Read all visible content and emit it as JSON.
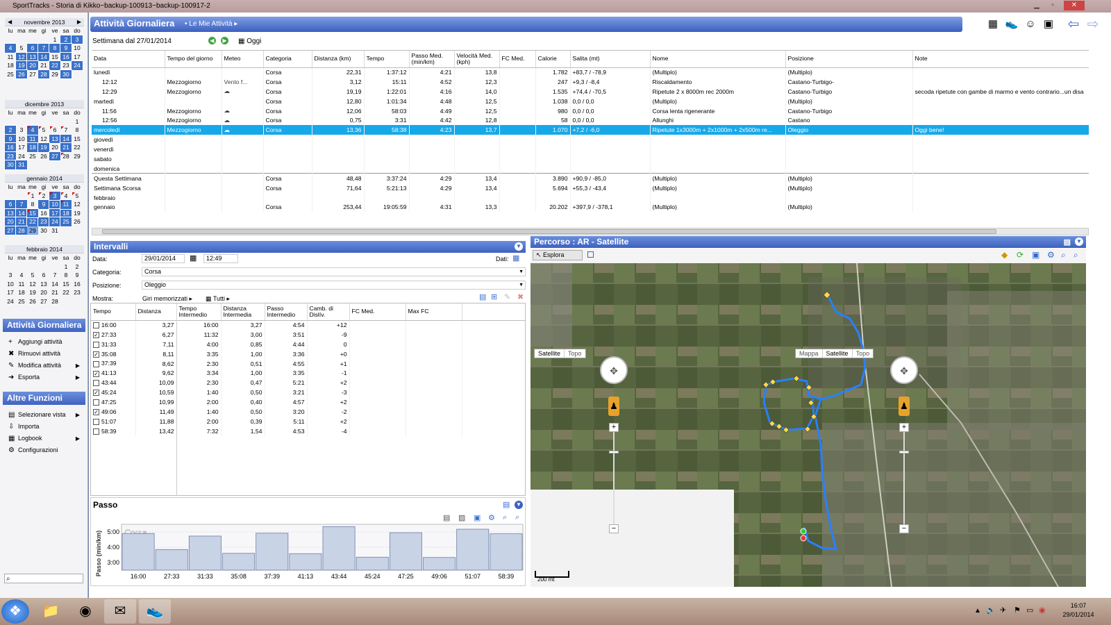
{
  "window": {
    "title": "SportTracks - Storia di Kikko~backup-100913~backup-100917-2"
  },
  "calendar": {
    "weekdays": [
      "lu",
      "ma",
      "me",
      "gi",
      "ve",
      "sa",
      "do"
    ],
    "months": [
      {
        "name": "novembre 2013",
        "lead": 4,
        "days": 30,
        "act": [
          2,
          3,
          4,
          6,
          7,
          8,
          9,
          12,
          13,
          14,
          16,
          19,
          20,
          22,
          24,
          26,
          28,
          30
        ],
        "flag": [],
        "today": []
      },
      {
        "name": "dicembre 2013",
        "lead": 6,
        "days": 31,
        "act": [
          2,
          4,
          9,
          11,
          13,
          14,
          16,
          18,
          19,
          21,
          23,
          27,
          30,
          31
        ],
        "flag": [
          4,
          5,
          6,
          7,
          28
        ],
        "today": []
      },
      {
        "name": "gennaio 2014",
        "lead": 2,
        "days": 31,
        "act": [
          3,
          6,
          7,
          9,
          10,
          11,
          13,
          14,
          15,
          17,
          18,
          20,
          21,
          22,
          23,
          24,
          25,
          27,
          28
        ],
        "flag": [
          1,
          2,
          3,
          4,
          5,
          11,
          15
        ],
        "today": [
          29
        ]
      },
      {
        "name": "febbraio 2014",
        "lead": 5,
        "days": 28,
        "act": [],
        "flag": [],
        "today": []
      }
    ]
  },
  "sidebar": {
    "panel1": {
      "title": "Attività Giornaliera",
      "items": [
        {
          "icon": "+",
          "label": "Aggiungi attività",
          "arrow": ""
        },
        {
          "icon": "✖",
          "label": "Rimuovi attività",
          "arrow": ""
        },
        {
          "icon": "✎",
          "label": "Modifica attività",
          "arrow": "▶"
        },
        {
          "icon": "➜",
          "label": "Esporta",
          "arrow": "▶"
        }
      ]
    },
    "panel2": {
      "title": "Altre Funzioni",
      "items": [
        {
          "icon": "▤",
          "label": "Selezionare vista",
          "arrow": "▶"
        },
        {
          "icon": "⇩",
          "label": "Importa",
          "arrow": ""
        },
        {
          "icon": "▦",
          "label": "Logbook",
          "arrow": "▶"
        },
        {
          "icon": "⚙",
          "label": "Configurazioni",
          "arrow": ""
        }
      ]
    }
  },
  "header": {
    "title": "Attività Giornaliera",
    "subtitle": "• Le Mie Attività ▸",
    "week": "Settimana dal 27/01/2014",
    "today": "Oggi"
  },
  "activities": {
    "columns": [
      "Data",
      "Tempo del giorno",
      "Meteo",
      "Categoria",
      "Distanza (km)",
      "Tempo",
      "Passo Med. (min/km)",
      "Velocità Med. (kph)",
      "FC Med.",
      "Calorie",
      "Salita (mt)",
      "Nome",
      "Posizione",
      "Note"
    ],
    "rows": [
      {
        "c": [
          "lunedì",
          "",
          "",
          "Corsa",
          "22,31",
          "1:37:12",
          "4:21",
          "13,8",
          "",
          "1.782",
          "+83,7 / -78,9",
          "(Multiplo)",
          "(Multiplo)",
          ""
        ],
        "t": "day"
      },
      {
        "c": [
          "12:12",
          "Mezzogiorno",
          "Vento f...",
          "Corsa",
          "3,12",
          "15:11",
          "4:52",
          "12,3",
          "",
          "247",
          "+9,3 / -8,4",
          "Riscaldamento",
          "Castano-Turbigo-",
          ""
        ],
        "t": "sub"
      },
      {
        "c": [
          "12:29",
          "Mezzogiorno",
          "☁",
          "Corsa",
          "19,19",
          "1:22:01",
          "4:16",
          "14,0",
          "",
          "1.535",
          "+74,4 / -70,5",
          "Ripetute 2 x 8000m rec 2000m",
          "Castano-Turbigo",
          "secoda ripetute con gambe di marmo e vento contrario...un disa"
        ],
        "t": "sub"
      },
      {
        "c": [
          "martedì",
          "",
          "",
          "Corsa",
          "12,80",
          "1:01:34",
          "4:48",
          "12,5",
          "",
          "1.038",
          "0,0 / 0,0",
          "(Multiplo)",
          "(Multiplo)",
          ""
        ],
        "t": "day"
      },
      {
        "c": [
          "11:56",
          "Mezzogiorno",
          "☁",
          "Corsa",
          "12,06",
          "58:03",
          "4:49",
          "12,5",
          "",
          "980",
          "0,0 / 0,0",
          "Corsa lenta rigenerante",
          "Castano-Turbigo",
          ""
        ],
        "t": "sub"
      },
      {
        "c": [
          "12:56",
          "Mezzogiorno",
          "☁",
          "Corsa",
          "0,75",
          "3:31",
          "4:42",
          "12,8",
          "",
          "58",
          "0,0 / 0,0",
          "Allunghi",
          "Castano",
          ""
        ],
        "t": "sub"
      },
      {
        "c": [
          "mercoledì",
          "Mezzogiorno",
          "☁",
          "Corsa",
          "13,36",
          "58:38",
          "4:23",
          "13,7",
          "",
          "1.070",
          "+7,2 / -6,0",
          "Ripetute 1x3000m + 2x1000m + 2x500m re...",
          "Oleggio",
          "Oggi bene!"
        ],
        "t": "sel"
      },
      {
        "c": [
          "giovedì",
          "",
          "",
          "",
          "",
          "",
          "",
          "",
          "",
          "",
          "",
          "",
          "",
          ""
        ],
        "t": "day"
      },
      {
        "c": [
          "venerdì",
          "",
          "",
          "",
          "",
          "",
          "",
          "",
          "",
          "",
          "",
          "",
          "",
          ""
        ],
        "t": "day"
      },
      {
        "c": [
          "sabato",
          "",
          "",
          "",
          "",
          "",
          "",
          "",
          "",
          "",
          "",
          "",
          "",
          ""
        ],
        "t": "day"
      },
      {
        "c": [
          "domenica",
          "",
          "",
          "",
          "",
          "",
          "",
          "",
          "",
          "",
          "",
          "",
          "",
          ""
        ],
        "t": "day"
      },
      {
        "c": [
          "Questa Settimana",
          "",
          "",
          "Corsa",
          "48,48",
          "3:37:24",
          "4:29",
          "13,4",
          "",
          "3.890",
          "+90,9 / -85,0",
          "(Multiplo)",
          "(Multiplo)",
          ""
        ],
        "t": "sep"
      },
      {
        "c": [
          "Settimana Scorsa",
          "",
          "",
          "Corsa",
          "71,64",
          "5:21:13",
          "4:29",
          "13,4",
          "",
          "5.694",
          "+55,3 / -43,4",
          "(Multiplo)",
          "(Multiplo)",
          ""
        ],
        "t": "day"
      },
      {
        "c": [
          "febbraio",
          "",
          "",
          "",
          "",
          "",
          "",
          "",
          "",
          "",
          "",
          "",
          "",
          ""
        ],
        "t": "day"
      },
      {
        "c": [
          "gennaio",
          "",
          "",
          "Corsa",
          "253,44",
          "19:05:59",
          "4:31",
          "13,3",
          "",
          "20.202",
          "+397,9 / -378,1",
          "(Multiplo)",
          "(Multiplo)",
          ""
        ],
        "t": "day"
      }
    ]
  },
  "intervals": {
    "title": "Intervalli",
    "date_label": "Data:",
    "date": "29/01/2014",
    "time": "12:49",
    "dati_label": "Dati:",
    "cat_label": "Categoria:",
    "cat": "Corsa",
    "pos_label": "Posizione:",
    "pos": "Oleggio",
    "show_label": "Mostra:",
    "show": "Giri memorizzati",
    "all": "Tutti",
    "columns": [
      "Tempo",
      "Distanza",
      "Tempo Intermedio",
      "Distanza Intermedia",
      "Passo Intermedio",
      "Camb. di Dislív.",
      "FC Med.",
      "Max FC"
    ],
    "rows": [
      {
        "ck": false,
        "c": [
          "16:00",
          "3,27",
          "16:00",
          "3,27",
          "4:54",
          "+12"
        ]
      },
      {
        "ck": true,
        "c": [
          "27:33",
          "6,27",
          "11:32",
          "3,00",
          "3:51",
          "-9"
        ]
      },
      {
        "ck": false,
        "c": [
          "31:33",
          "7,11",
          "4:00",
          "0,85",
          "4:44",
          "0"
        ]
      },
      {
        "ck": true,
        "c": [
          "35:08",
          "8,11",
          "3:35",
          "1,00",
          "3:36",
          "+0"
        ]
      },
      {
        "ck": false,
        "c": [
          "37:39",
          "8,62",
          "2:30",
          "0,51",
          "4:55",
          "+1"
        ]
      },
      {
        "ck": true,
        "c": [
          "41:13",
          "9,62",
          "3:34",
          "1,00",
          "3:35",
          "-1"
        ]
      },
      {
        "ck": false,
        "c": [
          "43:44",
          "10,09",
          "2:30",
          "0,47",
          "5:21",
          "+2"
        ]
      },
      {
        "ck": true,
        "c": [
          "45:24",
          "10,59",
          "1:40",
          "0,50",
          "3:21",
          "-3"
        ]
      },
      {
        "ck": false,
        "c": [
          "47:25",
          "10,99",
          "2:00",
          "0,40",
          "4:57",
          "+2"
        ]
      },
      {
        "ck": true,
        "c": [
          "49:06",
          "11,49",
          "1:40",
          "0,50",
          "3:20",
          "-2"
        ]
      },
      {
        "ck": false,
        "c": [
          "51:07",
          "11,88",
          "2:00",
          "0,39",
          "5:11",
          "+2"
        ]
      },
      {
        "ck": false,
        "c": [
          "58:39",
          "13,42",
          "7:32",
          "1,54",
          "4:53",
          "-4"
        ]
      }
    ]
  },
  "chart_data": {
    "type": "bar",
    "title": "Passo",
    "series_label": "Corsa",
    "ylabel": "Passo (min/km)",
    "yticks": [
      "5:00",
      "4:00",
      "3:00"
    ],
    "categories": [
      "16:00",
      "27:33",
      "31:33",
      "35:08",
      "37:39",
      "41:13",
      "43:44",
      "45:24",
      "47:25",
      "49:06",
      "51:07",
      "58:39"
    ],
    "values": [
      4.9,
      3.85,
      4.73,
      3.6,
      4.92,
      3.58,
      5.35,
      3.35,
      4.95,
      3.33,
      5.18,
      4.88
    ],
    "ylim": [
      2.5,
      5.5
    ]
  },
  "map": {
    "title": "Percorso  : AR - Satellite",
    "explore": "Esplora",
    "tabs1": [
      "Satellite",
      "Topo"
    ],
    "tabs2": [
      "Mappa",
      "Satellite",
      "Topo"
    ],
    "scale": "200 mt"
  },
  "taskbar": {
    "time": "16:07",
    "date": "29/01/2014"
  }
}
